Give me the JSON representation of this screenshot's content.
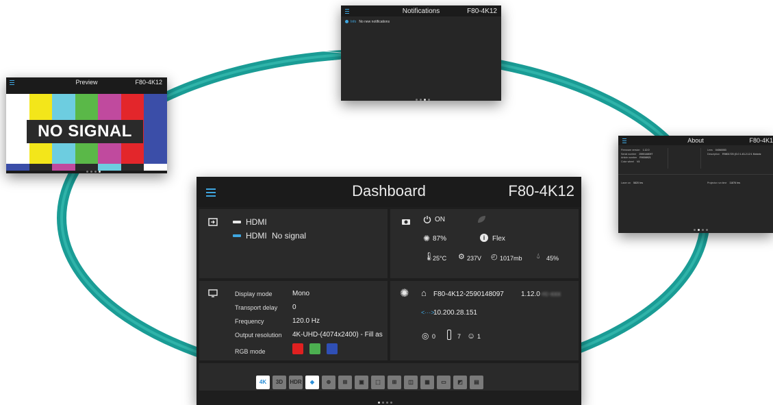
{
  "colors": {
    "accent": "#3fa6e0",
    "ring": "#1ea39a",
    "panel_bg": "#2a2a2a",
    "rgb_red": "#e02020",
    "rgb_green": "#4caf50",
    "rgb_blue": "#2f4fb5"
  },
  "preview": {
    "title": "Preview",
    "model": "F80-4K12",
    "overlay_text": "NO SIGNAL",
    "menu_icon": "hamburger-icon",
    "bar_colors": [
      "#ffffff",
      "#f3e61a",
      "#6dcde0",
      "#5ab848",
      "#c04a9e",
      "#e3262b",
      "#3b4ea8"
    ],
    "low_colors": [
      "#3b4ea8",
      "#2a2a2a",
      "#c04a9e",
      "#2a2a2a",
      "#6dcde0",
      "#2a2a2a",
      "#ffffff"
    ]
  },
  "notifications": {
    "title": "Notifications",
    "model": "F80-4K12",
    "level": "Info",
    "message": "No new notifications"
  },
  "about": {
    "title": "About",
    "model": "F80-4K1",
    "firmware_label": "Firmware version",
    "firmware_value": "1.12.0",
    "serial_label": "Serial number",
    "serial_value": "2590148097",
    "article_label": "Article number",
    "article_value": "R9008921",
    "colorwheel_label": "Color wheel",
    "colorwheel_value": "V4",
    "lens_label": "Lens",
    "lens_value": "04060053",
    "description_label": "Description",
    "description_value": "R9801720 (G.0 1.43-2.12:1 Motoriz",
    "laser_label": "Laser on",
    "laser_value": "5820 hrs",
    "runtime_label": "Projector run time",
    "runtime_value": "11876 hrs"
  },
  "dashboard": {
    "title": "Dashboard",
    "model": "F80-4K12",
    "source": {
      "input_name": "HDMI",
      "input_status_name": "HDMI",
      "input_status": "No signal"
    },
    "status": {
      "power": "ON",
      "light_output": "87%",
      "mode": "Flex",
      "temperature": "25°C",
      "voltage": "237V",
      "pressure": "1017mb",
      "humidity": "45%"
    },
    "display": {
      "display_mode_label": "Display mode",
      "display_mode_value": "Mono",
      "transport_delay_label": "Transport delay",
      "transport_delay_value": "0",
      "frequency_label": "Frequency",
      "frequency_value": "120.0 Hz",
      "output_resolution_label": "Output resolution",
      "output_resolution_value": "4K-UHD-(4074x2400)   -   Fill as",
      "rgb_mode_label": "RGB mode"
    },
    "network": {
      "hostname": "F80-4K12-2590148097",
      "version": "1.12.0",
      "version_suffix": "-rc-xxx",
      "ip": "10.200.28.151",
      "arrows": "<···>",
      "wifi_count": "0",
      "remote_count": "7",
      "user_count": "1"
    },
    "toolbar_icons": [
      {
        "name": "4k-uhd-icon",
        "label": "4K"
      },
      {
        "name": "3d-icon",
        "label": "3D"
      },
      {
        "name": "hdr-icon",
        "label": "HDR"
      },
      {
        "name": "diamond-icon",
        "label": "◆"
      },
      {
        "name": "zoom-icon",
        "label": "⊕"
      },
      {
        "name": "warp-icon",
        "label": "⊞"
      },
      {
        "name": "blend-icon",
        "label": "▣"
      },
      {
        "name": "fit-icon",
        "label": "⬚"
      },
      {
        "name": "grid-icon",
        "label": "⊞"
      },
      {
        "name": "pip-icon",
        "label": "◫"
      },
      {
        "name": "pattern-icon",
        "label": "▦"
      },
      {
        "name": "window-icon",
        "label": "▭"
      },
      {
        "name": "contrast-icon",
        "label": "◩"
      },
      {
        "name": "image-icon",
        "label": "▤"
      }
    ]
  }
}
